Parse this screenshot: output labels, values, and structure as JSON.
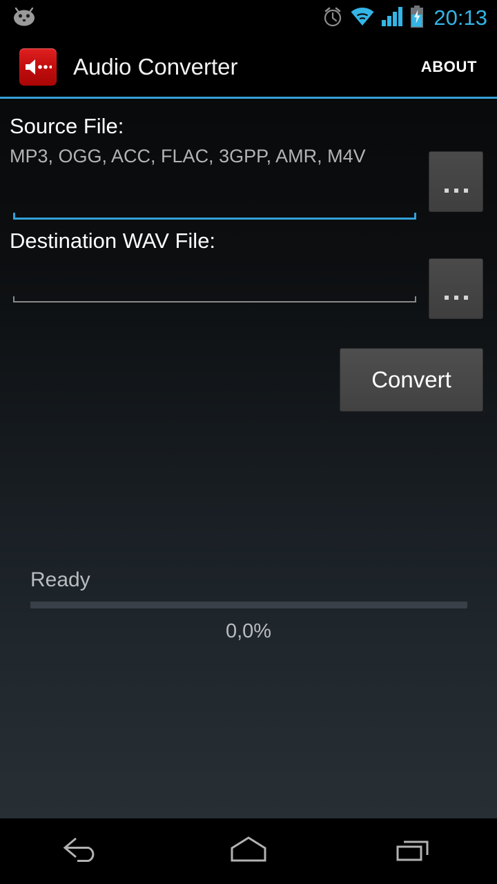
{
  "status_bar": {
    "notification_icon": "android-mascot-icon",
    "icons": [
      "alarm-clock-icon",
      "wifi-icon",
      "cellular-signal-icon",
      "battery-charging-icon"
    ],
    "clock": "20:13",
    "accent_color": "#33b5e5"
  },
  "action_bar": {
    "app_icon": "speaker-audio-icon",
    "title": "Audio Converter",
    "about_label": "ABOUT",
    "divider_color": "#33a2d8"
  },
  "main": {
    "source": {
      "label": "Source File:",
      "hint": "MP3, OGG, ACC, FLAC, 3GPP, AMR, M4V",
      "value": "",
      "browse_label": "...",
      "focused": true,
      "underline_color": "#33a2d8"
    },
    "destination": {
      "label": "Destination WAV File:",
      "hint": "",
      "value": "",
      "browse_label": "...",
      "focused": false,
      "underline_color": "#8a8a8a"
    },
    "convert_label": "Convert",
    "status_text": "Ready",
    "progress_percent_label": "0,0%",
    "progress_value": 0
  },
  "nav_bar": {
    "back": "back-icon",
    "home": "home-icon",
    "recents": "recents-icon"
  }
}
